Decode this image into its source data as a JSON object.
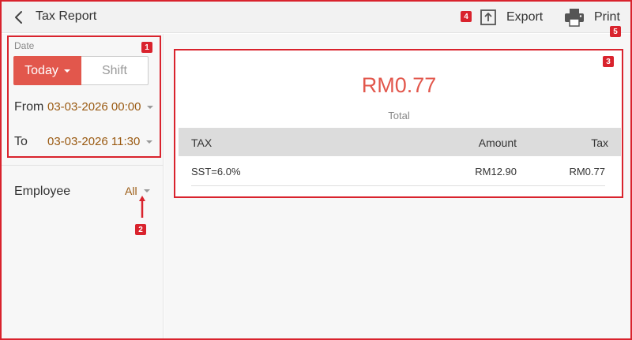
{
  "header": {
    "title": "Tax Report",
    "export_label": "Export",
    "print_label": "Print"
  },
  "sidebar": {
    "date_label": "Date",
    "today_label": "Today",
    "shift_label": "Shift",
    "from_label": "From",
    "from_value": "03-03-2026 00:00",
    "to_label": "To",
    "to_value": "03-03-2026 11:30",
    "employee_label": "Employee",
    "employee_value": "All"
  },
  "summary": {
    "total_value": "RM0.77",
    "total_label": "Total"
  },
  "table": {
    "columns": [
      "TAX",
      "Amount",
      "Tax"
    ],
    "rows": [
      [
        "SST=6.0%",
        "RM12.90",
        "RM0.77"
      ]
    ]
  },
  "annotations": {
    "badges": [
      "1",
      "2",
      "3",
      "4",
      "5"
    ]
  },
  "colors": {
    "accent": "#e2574c",
    "annotation": "#d9232d",
    "value_text": "#9a5a12"
  }
}
